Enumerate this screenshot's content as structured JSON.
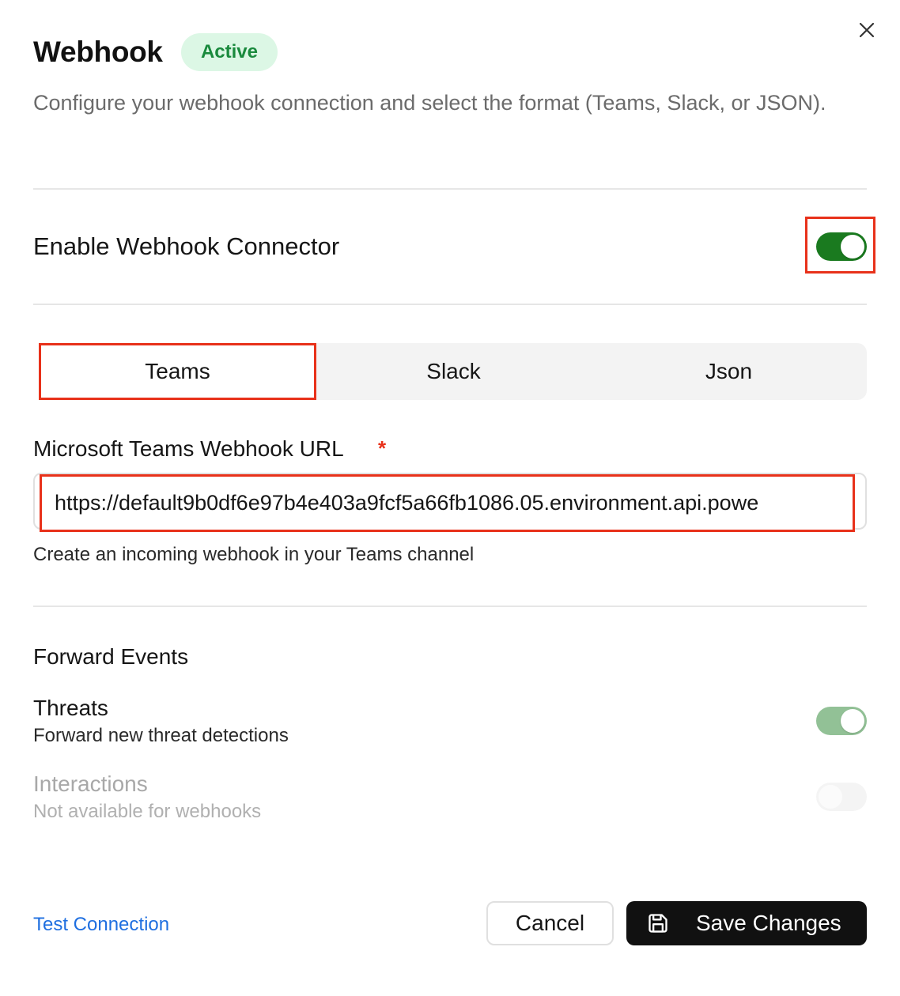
{
  "header": {
    "title": "Webhook",
    "status_badge": "Active",
    "description": "Configure your webhook connection and select the format (Teams, Slack, or JSON)."
  },
  "enable": {
    "label": "Enable Webhook Connector",
    "enabled": true
  },
  "format_tabs": {
    "selected": "Teams",
    "items": [
      "Teams",
      "Slack",
      "Json"
    ]
  },
  "url_field": {
    "label": "Microsoft Teams Webhook URL",
    "required_marker": "*",
    "value": "https://default9b0df6e97b4e403a9fcf5a66fb1086.05.environment.api.powe",
    "help_text": "Create an incoming webhook in your Teams channel"
  },
  "forward_events": {
    "title": "Forward Events",
    "items": [
      {
        "title": "Threats",
        "description": "Forward new threat detections",
        "enabled": true,
        "available": true
      },
      {
        "title": "Interactions",
        "description": "Not available for webhooks",
        "enabled": false,
        "available": false
      }
    ]
  },
  "footer": {
    "test_connection": "Test Connection",
    "cancel": "Cancel",
    "save": "Save Changes"
  },
  "colors": {
    "accent_green": "#1a7a1f",
    "badge_bg": "#dcf7e5",
    "badge_text": "#1a8a3d",
    "highlight_red": "#e8311a",
    "link_blue": "#1f6fe0",
    "primary_button": "#111111"
  },
  "icons": {
    "close": "close-icon",
    "save": "save-icon"
  }
}
